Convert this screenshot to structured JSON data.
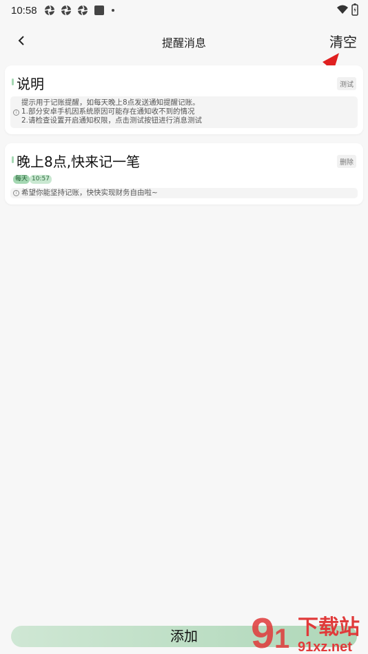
{
  "status_bar": {
    "time": "10:58",
    "icons": [
      "aperture-icon",
      "aperture-icon",
      "aperture-icon",
      "square-icon",
      "dot-icon"
    ],
    "right_icons": [
      "wifi-icon",
      "battery-icon"
    ]
  },
  "header": {
    "back_icon": "chevron-left-icon",
    "title": "提醒消息",
    "clear_label": "清空"
  },
  "cards": [
    {
      "title": "说明",
      "action_label": "测试",
      "info_lines": [
        "提示用于记账提醒，如每天晚上8点发送通知提醒记账。",
        "1.部分安卓手机因系统原因可能存在通知收不到的情况",
        "2.请检查设置开启通知权限，点击测试按钮进行消息测试"
      ]
    },
    {
      "title": "晚上8点,快来记一笔",
      "action_label": "删除",
      "tags": [
        "每天",
        "10:57"
      ],
      "info_lines": [
        "希望你能坚持记账，快快实现财务自由啦~"
      ]
    }
  ],
  "footer": {
    "add_label": "添加"
  },
  "watermark": {
    "text_top": "下载站",
    "text_bottom": "91xz.net"
  },
  "colors": {
    "accent_green": "#a5d8b3",
    "arrow_red": "#e02020",
    "background": "#f7f7f7"
  }
}
